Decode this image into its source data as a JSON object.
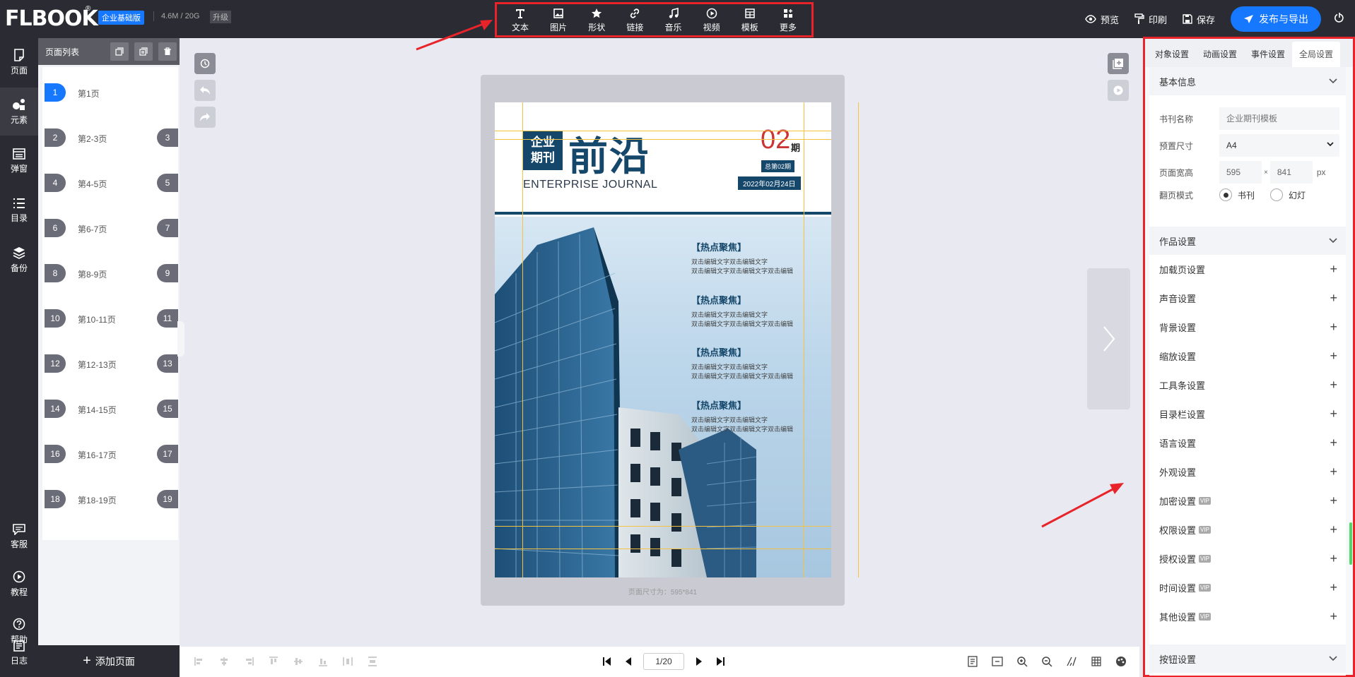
{
  "brand": {
    "logo": "FLBOOK",
    "reg": "®",
    "edition": "企业基础版",
    "storage": "4.6M / 20G",
    "upgrade": "升级"
  },
  "toolbar": [
    {
      "icon": "text-icon",
      "label": "文本"
    },
    {
      "icon": "image-icon",
      "label": "图片"
    },
    {
      "icon": "star-icon",
      "label": "形状"
    },
    {
      "icon": "link-icon",
      "label": "链接"
    },
    {
      "icon": "music-icon",
      "label": "音乐"
    },
    {
      "icon": "video-icon",
      "label": "视频"
    },
    {
      "icon": "template-icon",
      "label": "模板"
    },
    {
      "icon": "more-icon",
      "label": "更多"
    }
  ],
  "top_actions": {
    "preview": "预览",
    "print": "印刷",
    "save": "保存",
    "publish": "发布与导出"
  },
  "leftnav": [
    {
      "icon": "page-icon",
      "label": "页面"
    },
    {
      "icon": "elements-icon",
      "label": "元素"
    },
    {
      "icon": "popup-icon",
      "label": "弹窗"
    },
    {
      "icon": "toc-icon",
      "label": "目录"
    },
    {
      "icon": "backup-icon",
      "label": "备份"
    },
    {
      "icon": "service-icon",
      "label": "客服"
    },
    {
      "icon": "tutorial-icon",
      "label": "教程"
    },
    {
      "icon": "help-icon",
      "label": "帮助"
    },
    {
      "icon": "log-icon",
      "label": "日志"
    }
  ],
  "page_list": {
    "title": "页面列表",
    "add_label": "添加页面",
    "rows": [
      {
        "n1": "1",
        "label": "第1页",
        "n2": ""
      },
      {
        "n1": "2",
        "label": "第2-3页",
        "n2": "3"
      },
      {
        "n1": "4",
        "label": "第4-5页",
        "n2": "5"
      },
      {
        "n1": "6",
        "label": "第6-7页",
        "n2": "7"
      },
      {
        "n1": "8",
        "label": "第8-9页",
        "n2": "9"
      },
      {
        "n1": "10",
        "label": "第10-11页",
        "n2": "11"
      },
      {
        "n1": "12",
        "label": "第12-13页",
        "n2": "13"
      },
      {
        "n1": "14",
        "label": "第14-15页",
        "n2": "15"
      },
      {
        "n1": "16",
        "label": "第16-17页",
        "n2": "17"
      },
      {
        "n1": "18",
        "label": "第18-19页",
        "n2": "19"
      }
    ]
  },
  "cover": {
    "badge_line1": "企业",
    "badge_line2": "期刊",
    "title": "前沿",
    "subtitle": "ENTERPRISE JOURNAL",
    "issue": "02",
    "issue_unit": "期",
    "total_issue": "总第02期",
    "date": "2022年02月24日",
    "blocks": [
      {
        "head": "【热点聚焦】",
        "line1": "双击编辑文字双击编辑文字",
        "line2": "双击编辑文字双击编辑文字双击编辑"
      },
      {
        "head": "【热点聚焦】",
        "line1": "双击编辑文字双击编辑文字",
        "line2": "双击编辑文字双击编辑文字双击编辑"
      },
      {
        "head": "【热点聚焦】",
        "line1": "双击编辑文字双击编辑文字",
        "line2": "双击编辑文字双击编辑文字双击编辑"
      },
      {
        "head": "【热点聚焦】",
        "line1": "双击编辑文字双击编辑文字",
        "line2": "双击编辑文字双击编辑文字双击编辑"
      }
    ]
  },
  "canvas": {
    "size_hint": "页面尺寸为：595*841"
  },
  "pager": {
    "current": "1/20"
  },
  "settings": {
    "tabs": [
      "对象设置",
      "动画设置",
      "事件设置",
      "全局设置"
    ],
    "basic_title": "基本信息",
    "book_name_label": "书刊名称",
    "book_name_placeholder": "企业期刊模板",
    "preset_label": "预置尺寸",
    "preset_value": "A4",
    "size_label": "页面宽高",
    "width": "595",
    "times": "×",
    "height": "841",
    "unit": "px",
    "flip_label": "翻页模式",
    "flip_book": "书刊",
    "flip_slide": "幻灯",
    "work_title": "作品设置",
    "items": [
      {
        "label": "加载页设置",
        "vip": false
      },
      {
        "label": "声音设置",
        "vip": false
      },
      {
        "label": "背景设置",
        "vip": false
      },
      {
        "label": "缩放设置",
        "vip": false
      },
      {
        "label": "工具条设置",
        "vip": false
      },
      {
        "label": "目录栏设置",
        "vip": false
      },
      {
        "label": "语言设置",
        "vip": false
      },
      {
        "label": "外观设置",
        "vip": false
      },
      {
        "label": "加密设置",
        "vip": true
      },
      {
        "label": "权限设置",
        "vip": true
      },
      {
        "label": "授权设置",
        "vip": true
      },
      {
        "label": "时间设置",
        "vip": true
      },
      {
        "label": "其他设置",
        "vip": true
      }
    ],
    "vip_tag": "VIP",
    "button_title": "按钮设置"
  },
  "colors": {
    "accent": "#1677ff",
    "dark": "#2b2c33",
    "annotation": "#e8232a",
    "cover_blue": "#15476b"
  }
}
